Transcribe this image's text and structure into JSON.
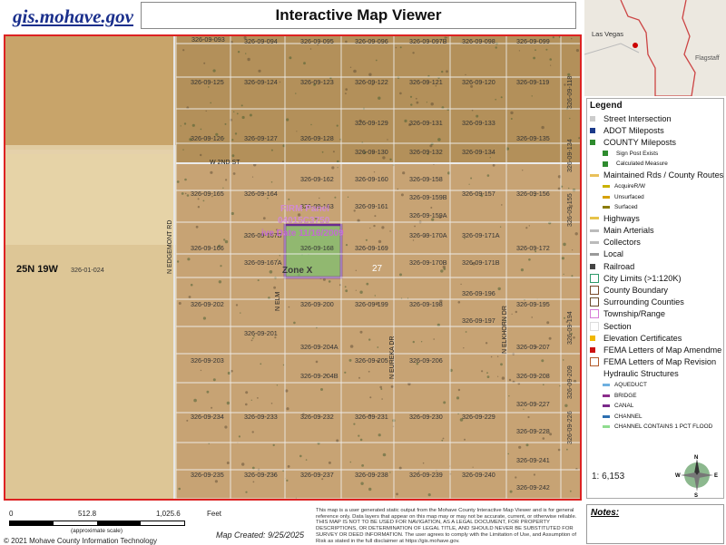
{
  "header": {
    "site_link": "gis.mohave.gov",
    "title": "Interactive Map Viewer"
  },
  "map": {
    "township_label": "25N 19W",
    "parcel_326_01_024": "326-01-024",
    "street_2nd": "W 2ND ST",
    "street_edgemont": "N EDGEMONT RD",
    "street_elm": "N ELM",
    "street_eureka": "N EUREKA DR",
    "street_elkhorn": "N ELKHORN DR",
    "parcels": [
      "326-09-093",
      "326-09-094",
      "326-09-095",
      "326-09-096",
      "326-09-097B",
      "326-09-098",
      "326-09-099",
      "326-09-118",
      "326-09-125",
      "326-09-124",
      "326-09-123",
      "326-09-122",
      "326-09-121",
      "326-09-120",
      "326-09-119",
      "326-09-129",
      "326-09-131",
      "326-09-133",
      "326-09-134",
      "326-09-126",
      "326-09-127",
      "326-09-128",
      "326-09-130",
      "326-09-132",
      "326-09-134",
      "326-09-135",
      "326-09-162",
      "326-09-160",
      "326-09-158",
      "326-09-155",
      "326-09-165",
      "326-09-164",
      "326-09-163",
      "326-09-161",
      "326-09-159B",
      "326-09-157",
      "326-09-156",
      "326-09-159A",
      "326-09-166",
      "326-09-167B",
      "326-09-168",
      "326-09-169",
      "326-09-170A",
      "326-09-171A",
      "326-09-172",
      "326-09-167A",
      "326-09-170B",
      "326-09-171B",
      "326-09-196",
      "326-09-202",
      "326-09-200",
      "326-09-199",
      "326-09-198",
      "326-09-195",
      "326-09-194",
      "326-09-197",
      "326-09-201",
      "326-09-204A",
      "326-09-207",
      "326-09-203",
      "326-09-205",
      "326-09-206",
      "326-09-209",
      "326-09-204B",
      "326-09-208",
      "326-09-227",
      "326-09-226",
      "326-09-234",
      "326-09-233",
      "326-09-232",
      "326-09-231",
      "326-09-230",
      "326-09-229",
      "326-09-228",
      "326-09-241",
      "326-09-235",
      "326-09-236",
      "326-09-237",
      "326-09-238",
      "326-09-239",
      "326-09-240",
      "326-09-242"
    ],
    "flood_zone_label": "Zone X",
    "firm_label_1": "FIRM Panel",
    "firm_label_2": "04015C3750",
    "firm_label_3": "ive Date 11/16/2009",
    "section_27": "27"
  },
  "inset": {
    "city_1": "Las Vegas",
    "city_2": "Flagstaff"
  },
  "legend": {
    "title": "Legend",
    "items": [
      {
        "label": "Street Intersection",
        "size": "normal"
      },
      {
        "label": "ADOT Mileposts",
        "size": "normal"
      },
      {
        "label": "COUNTY Mileposts",
        "size": "normal"
      },
      {
        "label": "Sign Post Exists",
        "size": "small"
      },
      {
        "label": "Calculated Measure",
        "size": "small"
      },
      {
        "label": "Maintained Rds / County Routes",
        "size": "normal"
      },
      {
        "label": "AcquireR/W",
        "size": "small"
      },
      {
        "label": "Unsurfaced",
        "size": "small"
      },
      {
        "label": "Surfaced",
        "size": "small"
      },
      {
        "label": "Highways",
        "size": "normal"
      },
      {
        "label": "Main Arterials",
        "size": "normal"
      },
      {
        "label": "Collectors",
        "size": "normal"
      },
      {
        "label": "Local",
        "size": "normal"
      },
      {
        "label": "Railroad",
        "size": "normal"
      },
      {
        "label": "City Limits (>1:120K)",
        "size": "normal"
      },
      {
        "label": "County Boundary",
        "size": "normal"
      },
      {
        "label": "Surrounding Counties",
        "size": "normal"
      },
      {
        "label": "Township/Range",
        "size": "normal"
      },
      {
        "label": "Section",
        "size": "normal"
      },
      {
        "label": "Elevation Certificates",
        "size": "normal"
      },
      {
        "label": "FEMA Letters of Map Amendme",
        "size": "normal"
      },
      {
        "label": "FEMA Letters of Map Revision",
        "size": "normal"
      },
      {
        "label": "Hydraulic Structures",
        "size": "normal"
      },
      {
        "label": "AQUEDUCT",
        "size": "small"
      },
      {
        "label": "BRIDGE",
        "size": "small"
      },
      {
        "label": "CANAL",
        "size": "small"
      },
      {
        "label": "CHANNEL",
        "size": "small"
      },
      {
        "label": "CHANNEL CONTAINS 1 PCT FLOOD",
        "size": "small"
      }
    ],
    "swatch_colors": [
      "#ccc",
      "#1b3a8a",
      "#2e8b2e",
      "#2e8b2e",
      "#2e8b2e",
      "#e9c05a",
      "#c9b200",
      "#d6a100",
      "#8a7b00",
      "#e7c34a",
      "#bbb",
      "#bbb",
      "#999",
      "#444",
      "#2e9a6a",
      "#7a4a2a",
      "#6b4b2b",
      "#d77bd7",
      "#ddd",
      "#f0b700",
      "#c11",
      "#b35a2a",
      "#fff",
      "#6fb0e0",
      "#8b2d8b",
      "#7a2a8a",
      "#2d6fb0",
      "#8fdc8f"
    ],
    "scale_text": "1: 6,153"
  },
  "footer": {
    "scale_0": "0",
    "scale_1": "512.8",
    "scale_2": "1,025.6",
    "scale_unit": "Feet",
    "scale_note": "(approximate scale)",
    "map_created": "Map Created: 9/25/2025",
    "disclaimer": "This map is a user generated static output from the Mohave County Interactive Map Viewer and is for general reference only. Data layers that appear on this map may or may not be accurate, current, or otherwise reliable. THIS MAP IS NOT TO BE USED FOR NAVIGATION, AS A LEGAL DOCUMENT, FOR PROPERTY DESCRIPTIONS, OR DETERMINATION OF LEGAL TITLE, AND SHOULD NEVER BE SUBSTITUTED FOR SURVEY OR DEED INFORMATION. The user agrees to comply with the Limitation of Use, and Assumption of Risk as stated in the full disclaimer at https://gis.mohave.gov.",
    "copyright": "© 2021 Mohave County Information Technology",
    "notes": "Notes:"
  }
}
